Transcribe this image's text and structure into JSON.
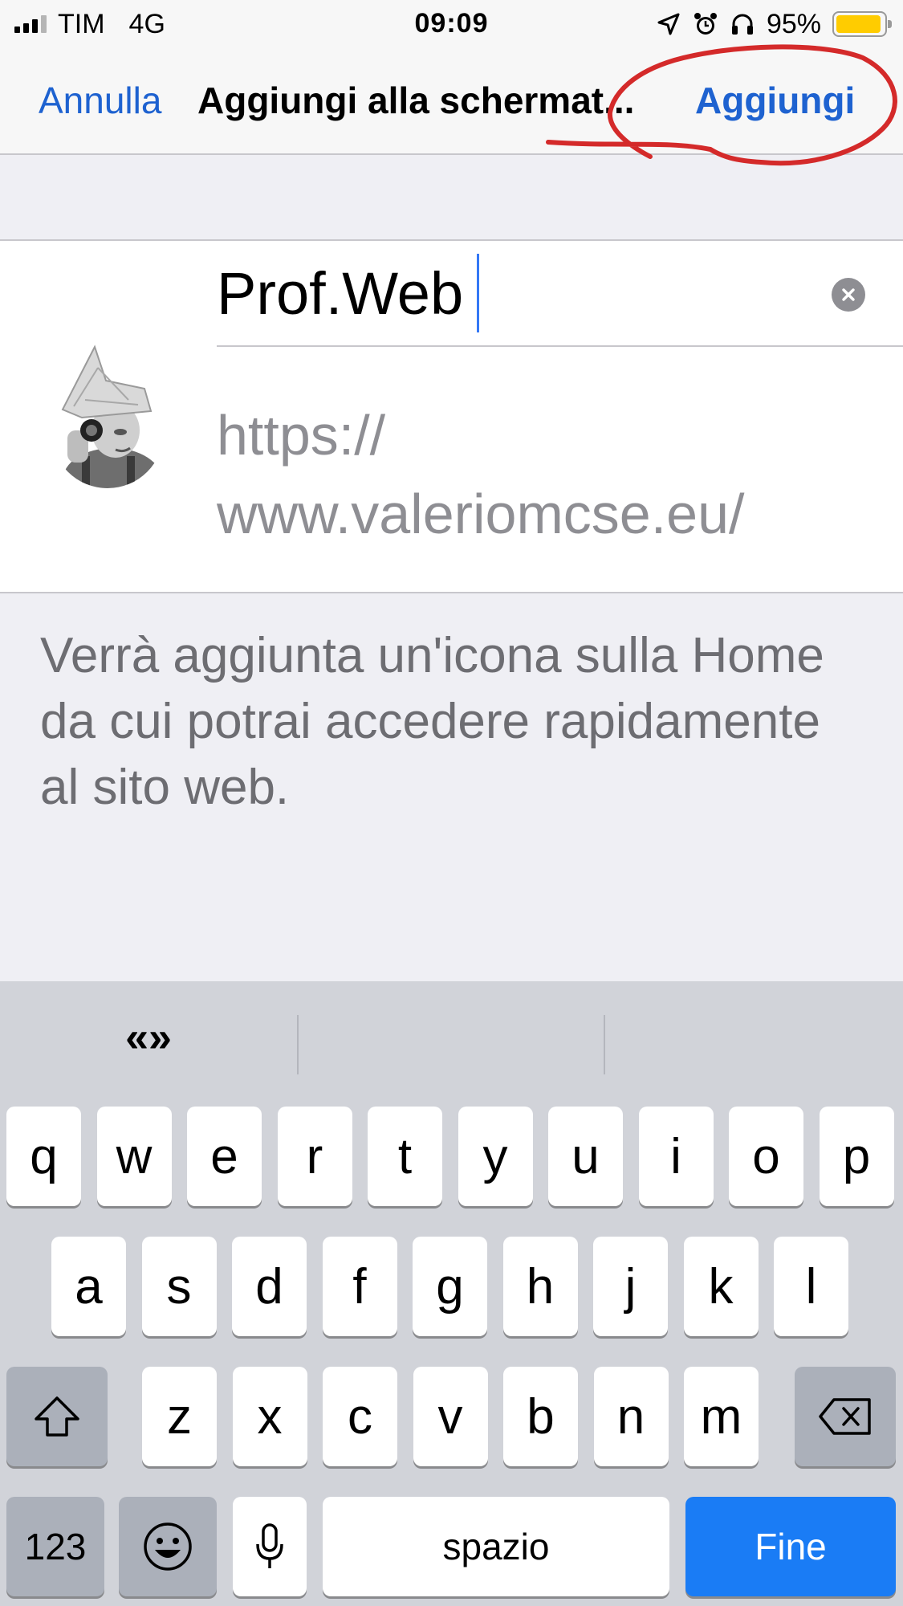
{
  "status_bar": {
    "carrier": "TIM",
    "network": "4G",
    "time": "09:09",
    "battery": "95%",
    "battery_level": 0.95,
    "icons": [
      "location-arrow-icon",
      "alarm-icon",
      "headphones-icon"
    ]
  },
  "nav": {
    "cancel_label": "Annulla",
    "title": "Aggiungi alla schermat...",
    "add_label": "Aggiungi",
    "accent_color": "#1e62d0"
  },
  "form": {
    "name_value": "Prof.Web",
    "url": "https://\nwww.valeriomcse.eu/"
  },
  "info": {
    "text": "Verrà aggiunta un'icona sulla Home da cui potrai accedere rapidamente al sito web."
  },
  "keyboard": {
    "predictive": [
      "«»",
      "",
      ""
    ],
    "row1": [
      "q",
      "w",
      "e",
      "r",
      "t",
      "y",
      "u",
      "i",
      "o",
      "p"
    ],
    "row2": [
      "a",
      "s",
      "d",
      "f",
      "g",
      "h",
      "j",
      "k",
      "l"
    ],
    "row3": [
      "z",
      "x",
      "c",
      "v",
      "b",
      "n",
      "m"
    ],
    "numbers_label": "123",
    "space_label": "spazio",
    "done_label": "Fine",
    "done_color": "#1a7cf5"
  }
}
